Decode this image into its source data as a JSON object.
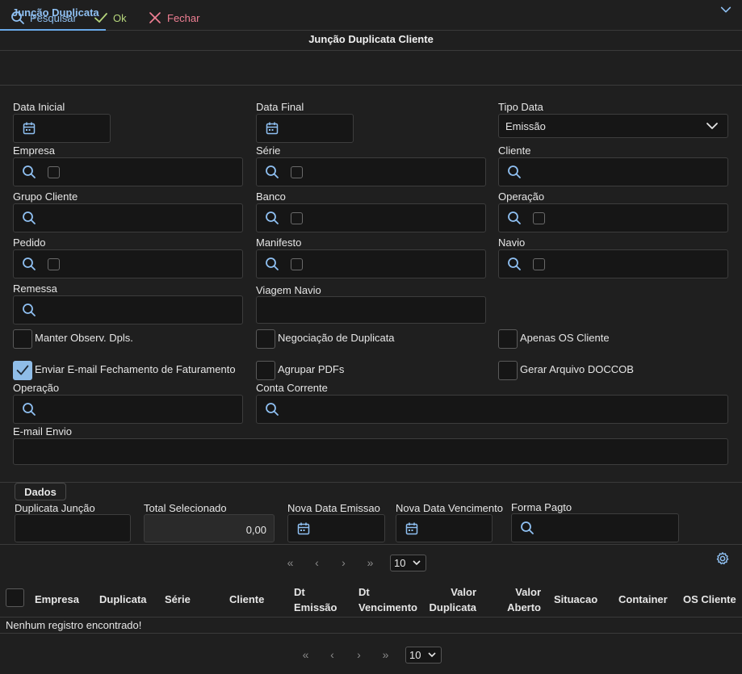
{
  "tab": {
    "label": "Junção Duplicata"
  },
  "page": {
    "title": "Junção Duplicata Cliente"
  },
  "toolbar": {
    "search_label": "Pesquisar",
    "ok_label": "Ok",
    "close_label": "Fechar"
  },
  "colors": {
    "accent": "#8fc0f2",
    "ok": "#b6d67c",
    "close": "#ef7f93",
    "panel": "#161616"
  },
  "filters": {
    "data_inicial": "Data Inicial",
    "data_final": "Data Final",
    "tipo_data": "Tipo Data",
    "tipo_data_value": "Emissão",
    "empresa": "Empresa",
    "serie": "Série",
    "cliente": "Cliente",
    "grupo_cliente": "Grupo Cliente",
    "banco": "Banco",
    "operacao": "Operação",
    "pedido": "Pedido",
    "manifesto": "Manifesto",
    "navio": "Navio",
    "remessa": "Remessa",
    "viagem_navio": "Viagem Navio"
  },
  "options": {
    "manter_obs": "Manter Observ. Dpls.",
    "negociacao": "Negociação de Duplicata",
    "apenas_os": "Apenas OS Cliente",
    "enviar_email": "Enviar E-mail Fechamento de Faturamento",
    "enviar_email_checked": true,
    "agrupar_pdfs": "Agrupar PDFs",
    "gerar_doccob": "Gerar Arquivo DOCCOB"
  },
  "email_section": {
    "operacao": "Operação",
    "conta_corrente": "Conta Corrente",
    "email_envio": "E-mail Envio"
  },
  "dados": {
    "legend": "Dados",
    "duplicata_juncao": "Duplicata Junção",
    "total_selecionado": "Total Selecionado",
    "total_value": "0,00",
    "nova_data_emissao": "Nova Data Emissao",
    "nova_data_vencimento": "Nova Data Vencimento",
    "forma_pagto": "Forma Pagto"
  },
  "pager": {
    "first": "«",
    "prev": "‹",
    "next": "›",
    "last": "»",
    "page_size": "10"
  },
  "table": {
    "columns": {
      "empresa": "Empresa",
      "duplicata": "Duplicata",
      "serie": "Série",
      "cliente": "Cliente",
      "dt_emissao_1": "Dt",
      "dt_emissao_2": "Emissão",
      "dt_venc_1": "Dt",
      "dt_venc_2": "Vencimento",
      "valor_dup_1": "Valor",
      "valor_dup_2": "Duplicata",
      "valor_ab_1": "Valor",
      "valor_ab_2": "Aberto",
      "situacao": "Situacao",
      "container": "Container",
      "os_cliente": "OS Cliente"
    },
    "empty_message": "Nenhum registro encontrado!"
  }
}
